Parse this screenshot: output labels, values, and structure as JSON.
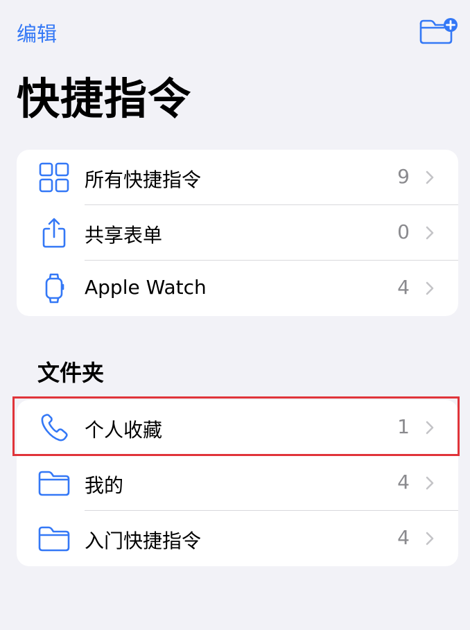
{
  "header": {
    "edit_label": "编辑",
    "new_folder_icon": "folder-badge-plus-icon",
    "title": "快捷指令"
  },
  "top_list": [
    {
      "label": "所有快捷指令",
      "count": "9",
      "icon": "grid-icon"
    },
    {
      "label": "共享表单",
      "count": "0",
      "icon": "share-icon"
    },
    {
      "label": "Apple Watch",
      "count": "4",
      "icon": "watch-icon"
    }
  ],
  "folders": {
    "header": "文件夹",
    "items": [
      {
        "label": "个人收藏",
        "count": "1",
        "icon": "phone-icon"
      },
      {
        "label": "我的",
        "count": "4",
        "icon": "folder-icon"
      },
      {
        "label": "入门快捷指令",
        "count": "4",
        "icon": "folder-icon"
      }
    ]
  },
  "colors": {
    "accent": "#3478f6",
    "background": "#f2f2f7",
    "count_gray": "#8a8a8e",
    "highlight": "#e0343a"
  }
}
